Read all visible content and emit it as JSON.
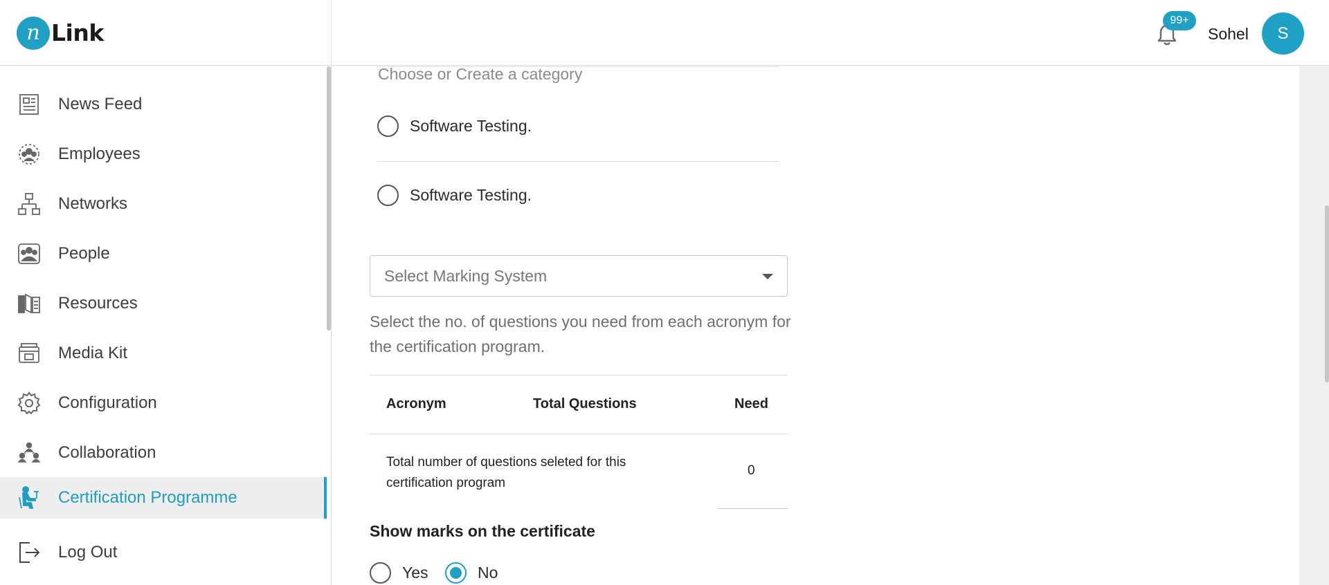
{
  "header": {
    "logo_mark": "n",
    "logo_text": "Link",
    "notification_count": "99+",
    "user_name": "Sohel",
    "avatar_initial": "S"
  },
  "sidebar": {
    "items": [
      {
        "label": "News Feed",
        "icon": "newspaper-icon"
      },
      {
        "label": "Employees",
        "icon": "employees-icon"
      },
      {
        "label": "Networks",
        "icon": "network-icon"
      },
      {
        "label": "People",
        "icon": "people-icon"
      },
      {
        "label": "Resources",
        "icon": "book-icon"
      },
      {
        "label": "Media Kit",
        "icon": "media-kit-icon"
      },
      {
        "label": "Configuration",
        "icon": "gear-icon"
      },
      {
        "label": "Collaboration",
        "icon": "collaboration-icon"
      },
      {
        "label": "Certification Programme",
        "icon": "certification-icon",
        "active": true
      },
      {
        "label": "Log Out",
        "icon": "logout-icon"
      }
    ]
  },
  "form": {
    "category_placeholder": "Choose or Create a category",
    "category_options": [
      "Software Testing.",
      "Software Testing."
    ],
    "marking_system_placeholder": "Select Marking System",
    "help_text": "Select the no. of questions you need from each acronym for the certification program.",
    "table": {
      "headers": [
        "Acronym",
        "Total Questions",
        "Need"
      ],
      "total_row_label": "Total number of questions seleted for this certification program",
      "total_row_value": "0"
    },
    "show_marks_title": "Show marks on the certificate",
    "show_marks_options": [
      "Yes",
      "No"
    ],
    "show_marks_selected": "No"
  },
  "colors": {
    "accent": "#1fa0c4",
    "active_bg": "#eeeeee"
  }
}
